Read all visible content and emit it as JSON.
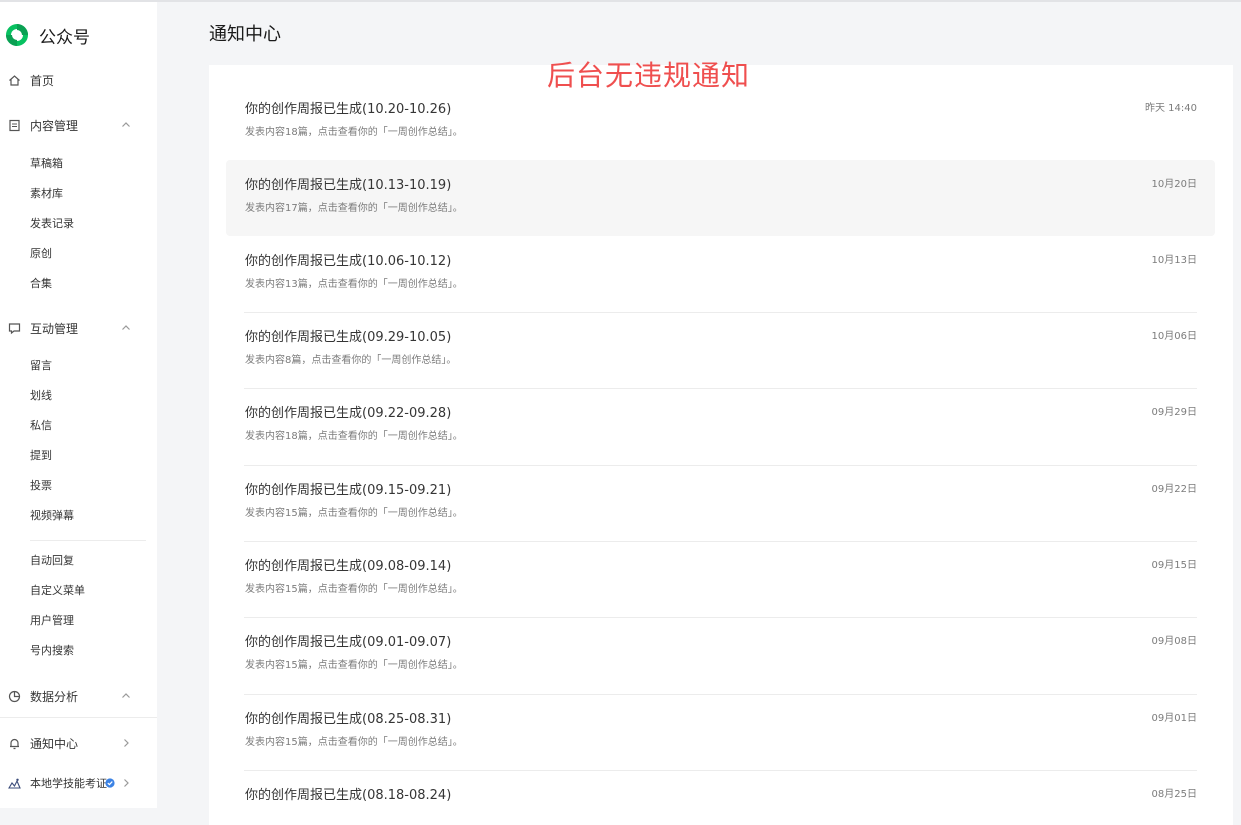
{
  "brand": {
    "name": "公众号"
  },
  "sidebar": {
    "home": {
      "label": "首页"
    },
    "content": {
      "label": "内容管理",
      "items": [
        "草稿箱",
        "素材库",
        "发表记录",
        "原创",
        "合集"
      ]
    },
    "interaction": {
      "label": "互动管理",
      "items": [
        "留言",
        "划线",
        "私信",
        "提到",
        "投票",
        "视频弹幕"
      ],
      "items2": [
        "自动回复",
        "自定义菜单",
        "用户管理",
        "号内搜索"
      ]
    },
    "analytics": {
      "label": "数据分析"
    },
    "notifications": {
      "label": "通知中心"
    },
    "account": {
      "label": "本地学技能考证"
    }
  },
  "page": {
    "title": "通知中心"
  },
  "overlay_note": "后台无违规通知",
  "notifications": [
    {
      "title": "你的创作周报已生成(10.20-10.26)",
      "desc": "发表内容18篇，点击查看你的「一周创作总结」。",
      "time": "昨天 14:40"
    },
    {
      "title": "你的创作周报已生成(10.13-10.19)",
      "desc": "发表内容17篇，点击查看你的「一周创作总结」。",
      "time": "10月20日"
    },
    {
      "title": "你的创作周报已生成(10.06-10.12)",
      "desc": "发表内容13篇，点击查看你的「一周创作总结」。",
      "time": "10月13日"
    },
    {
      "title": "你的创作周报已生成(09.29-10.05)",
      "desc": "发表内容8篇，点击查看你的「一周创作总结」。",
      "time": "10月06日"
    },
    {
      "title": "你的创作周报已生成(09.22-09.28)",
      "desc": "发表内容18篇，点击查看你的「一周创作总结」。",
      "time": "09月29日"
    },
    {
      "title": "你的创作周报已生成(09.15-09.21)",
      "desc": "发表内容15篇，点击查看你的「一周创作总结」。",
      "time": "09月22日"
    },
    {
      "title": "你的创作周报已生成(09.08-09.14)",
      "desc": "发表内容15篇，点击查看你的「一周创作总结」。",
      "time": "09月15日"
    },
    {
      "title": "你的创作周报已生成(09.01-09.07)",
      "desc": "发表内容15篇，点击查看你的「一周创作总结」。",
      "time": "09月08日"
    },
    {
      "title": "你的创作周报已生成(08.25-08.31)",
      "desc": "发表内容15篇，点击查看你的「一周创作总结」。",
      "time": "09月01日"
    },
    {
      "title": "你的创作周报已生成(08.18-08.24)",
      "desc": "",
      "time": "08月25日"
    }
  ],
  "colors": {
    "brand_green": "#07c160",
    "note_red": "#ef4f4f",
    "verified_blue": "#3b82e4"
  },
  "icons": {
    "home": "home-icon",
    "content": "document-icon",
    "interaction": "chat-bubble-icon",
    "analytics": "pie-chart-icon",
    "notifications": "bell-icon",
    "account": "avatar-icon",
    "verified": "verified-badge-icon",
    "collapse": "chevron-up-icon",
    "expand": "chevron-right-icon"
  }
}
